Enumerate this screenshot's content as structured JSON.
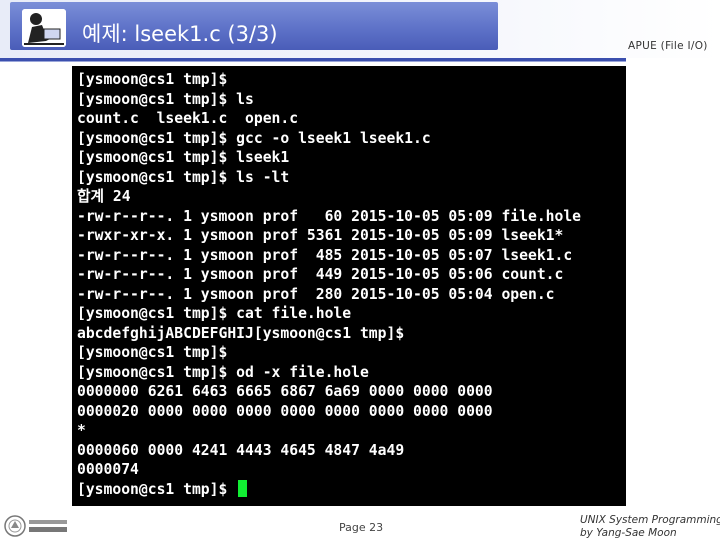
{
  "header": {
    "title": "예제: lseek1.c (3/3)",
    "right_label": "APUE (File I/O)",
    "title_bar_color": "#5e72c8"
  },
  "terminal": {
    "lines": [
      "[ysmoon@cs1 tmp]$",
      "[ysmoon@cs1 tmp]$ ls",
      "count.c  lseek1.c  open.c",
      "[ysmoon@cs1 tmp]$ gcc -o lseek1 lseek1.c",
      "[ysmoon@cs1 tmp]$ lseek1",
      "[ysmoon@cs1 tmp]$ ls -lt",
      "합계 24",
      "-rw-r--r--. 1 ysmoon prof   60 2015-10-05 05:09 file.hole",
      "-rwxr-xr-x. 1 ysmoon prof 5361 2015-10-05 05:09 lseek1*",
      "-rw-r--r--. 1 ysmoon prof  485 2015-10-05 05:07 lseek1.c",
      "-rw-r--r--. 1 ysmoon prof  449 2015-10-05 05:06 count.c",
      "-rw-r--r--. 1 ysmoon prof  280 2015-10-05 05:04 open.c",
      "[ysmoon@cs1 tmp]$ cat file.hole",
      "abcdefghijABCDEFGHIJ[ysmoon@cs1 tmp]$",
      "[ysmoon@cs1 tmp]$",
      "[ysmoon@cs1 tmp]$ od -x file.hole",
      "0000000 6261 6463 6665 6867 6a69 0000 0000 0000",
      "0000020 0000 0000 0000 0000 0000 0000 0000 0000",
      "*",
      "0000060 0000 4241 4443 4645 4847 4a49",
      "0000074",
      "[ysmoon@cs1 tmp]$ "
    ],
    "background": "#000000",
    "text_color": "#ffffff",
    "cursor_color": "#11ee33"
  },
  "footer": {
    "page": "Page 23",
    "credit_line1": "UNIX System Programming",
    "credit_line2": "by Yang-Sae Moon"
  }
}
